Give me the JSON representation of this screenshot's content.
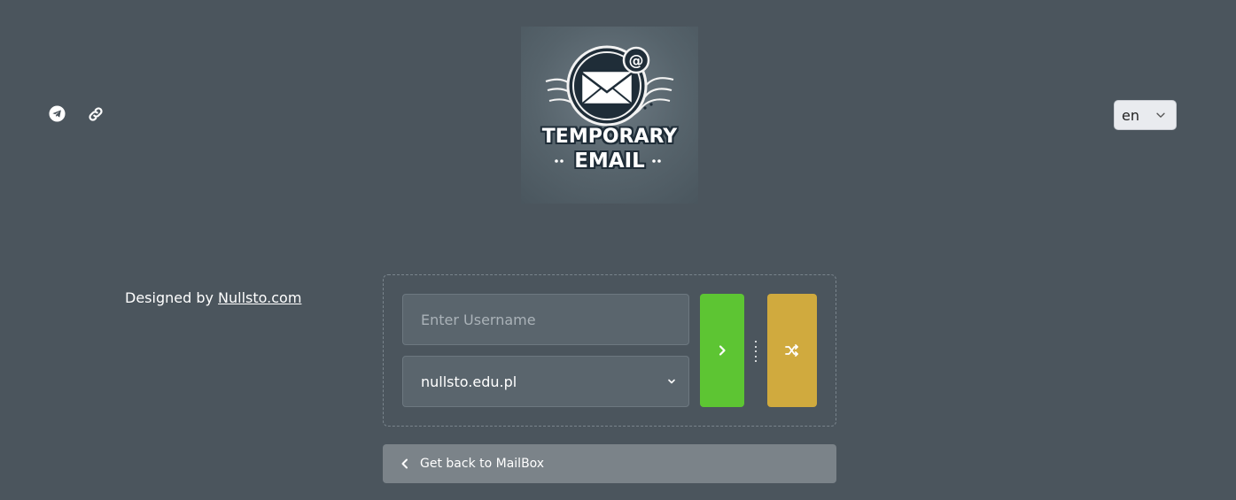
{
  "header": {
    "social": [
      {
        "icon": "telegram-icon"
      },
      {
        "icon": "link-icon"
      }
    ],
    "logo": {
      "line1": "TEMPORARY",
      "line2": "EMAIL"
    },
    "language": {
      "selected": "en"
    }
  },
  "footer_credit": {
    "prefix": "Designed by",
    "link_text": "Nullsto.com"
  },
  "form": {
    "username_placeholder": "Enter Username",
    "username_value": "",
    "domain_selected": "nullsto.edu.pl",
    "go_icon": "chevron-right-icon",
    "random_icon": "shuffle-icon"
  },
  "back_button": {
    "label": "Get back to MailBox",
    "icon": "chevron-left-icon"
  },
  "colors": {
    "background": "#4b555d",
    "go_button": "#5dc533",
    "random_button": "#d0aa3e",
    "back_button": "#7b8389",
    "input_bg": "#5a656d"
  }
}
